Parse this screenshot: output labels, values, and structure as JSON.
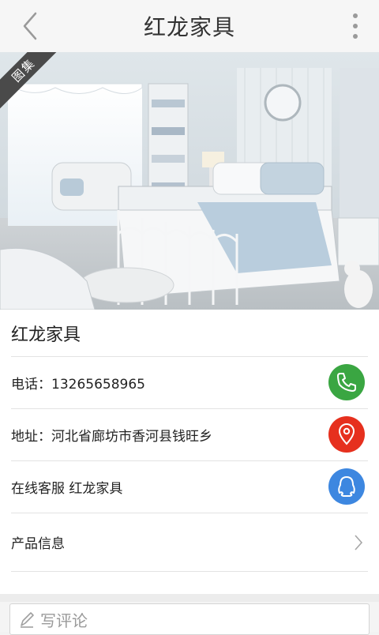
{
  "header": {
    "title": "红龙家具",
    "back_icon": "chevron-left-icon",
    "more_icon": "more-vertical-icon"
  },
  "photo": {
    "badge": "图集"
  },
  "details": {
    "name": "红龙家具",
    "phone": "电话：13265658965",
    "address": "地址：河北省廊坊市香河县钱旺乡",
    "service": "在线客服 红龙家具",
    "products": "产品信息",
    "colors": {
      "phone": "#3aa642",
      "address": "#e6301e",
      "service": "#3d87e0"
    }
  },
  "comment": {
    "placeholder": "写评论"
  }
}
